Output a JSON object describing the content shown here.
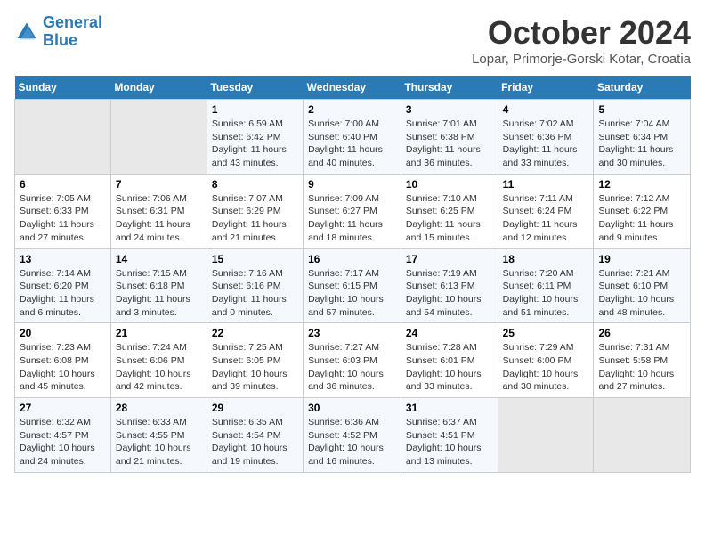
{
  "logo": {
    "line1": "General",
    "line2": "Blue"
  },
  "title": "October 2024",
  "subtitle": "Lopar, Primorje-Gorski Kotar, Croatia",
  "days_of_week": [
    "Sunday",
    "Monday",
    "Tuesday",
    "Wednesday",
    "Thursday",
    "Friday",
    "Saturday"
  ],
  "weeks": [
    [
      {
        "day": "",
        "info": ""
      },
      {
        "day": "",
        "info": ""
      },
      {
        "day": "1",
        "info": "Sunrise: 6:59 AM\nSunset: 6:42 PM\nDaylight: 11 hours and 43 minutes."
      },
      {
        "day": "2",
        "info": "Sunrise: 7:00 AM\nSunset: 6:40 PM\nDaylight: 11 hours and 40 minutes."
      },
      {
        "day": "3",
        "info": "Sunrise: 7:01 AM\nSunset: 6:38 PM\nDaylight: 11 hours and 36 minutes."
      },
      {
        "day": "4",
        "info": "Sunrise: 7:02 AM\nSunset: 6:36 PM\nDaylight: 11 hours and 33 minutes."
      },
      {
        "day": "5",
        "info": "Sunrise: 7:04 AM\nSunset: 6:34 PM\nDaylight: 11 hours and 30 minutes."
      }
    ],
    [
      {
        "day": "6",
        "info": "Sunrise: 7:05 AM\nSunset: 6:33 PM\nDaylight: 11 hours and 27 minutes."
      },
      {
        "day": "7",
        "info": "Sunrise: 7:06 AM\nSunset: 6:31 PM\nDaylight: 11 hours and 24 minutes."
      },
      {
        "day": "8",
        "info": "Sunrise: 7:07 AM\nSunset: 6:29 PM\nDaylight: 11 hours and 21 minutes."
      },
      {
        "day": "9",
        "info": "Sunrise: 7:09 AM\nSunset: 6:27 PM\nDaylight: 11 hours and 18 minutes."
      },
      {
        "day": "10",
        "info": "Sunrise: 7:10 AM\nSunset: 6:25 PM\nDaylight: 11 hours and 15 minutes."
      },
      {
        "day": "11",
        "info": "Sunrise: 7:11 AM\nSunset: 6:24 PM\nDaylight: 11 hours and 12 minutes."
      },
      {
        "day": "12",
        "info": "Sunrise: 7:12 AM\nSunset: 6:22 PM\nDaylight: 11 hours and 9 minutes."
      }
    ],
    [
      {
        "day": "13",
        "info": "Sunrise: 7:14 AM\nSunset: 6:20 PM\nDaylight: 11 hours and 6 minutes."
      },
      {
        "day": "14",
        "info": "Sunrise: 7:15 AM\nSunset: 6:18 PM\nDaylight: 11 hours and 3 minutes."
      },
      {
        "day": "15",
        "info": "Sunrise: 7:16 AM\nSunset: 6:16 PM\nDaylight: 11 hours and 0 minutes."
      },
      {
        "day": "16",
        "info": "Sunrise: 7:17 AM\nSunset: 6:15 PM\nDaylight: 10 hours and 57 minutes."
      },
      {
        "day": "17",
        "info": "Sunrise: 7:19 AM\nSunset: 6:13 PM\nDaylight: 10 hours and 54 minutes."
      },
      {
        "day": "18",
        "info": "Sunrise: 7:20 AM\nSunset: 6:11 PM\nDaylight: 10 hours and 51 minutes."
      },
      {
        "day": "19",
        "info": "Sunrise: 7:21 AM\nSunset: 6:10 PM\nDaylight: 10 hours and 48 minutes."
      }
    ],
    [
      {
        "day": "20",
        "info": "Sunrise: 7:23 AM\nSunset: 6:08 PM\nDaylight: 10 hours and 45 minutes."
      },
      {
        "day": "21",
        "info": "Sunrise: 7:24 AM\nSunset: 6:06 PM\nDaylight: 10 hours and 42 minutes."
      },
      {
        "day": "22",
        "info": "Sunrise: 7:25 AM\nSunset: 6:05 PM\nDaylight: 10 hours and 39 minutes."
      },
      {
        "day": "23",
        "info": "Sunrise: 7:27 AM\nSunset: 6:03 PM\nDaylight: 10 hours and 36 minutes."
      },
      {
        "day": "24",
        "info": "Sunrise: 7:28 AM\nSunset: 6:01 PM\nDaylight: 10 hours and 33 minutes."
      },
      {
        "day": "25",
        "info": "Sunrise: 7:29 AM\nSunset: 6:00 PM\nDaylight: 10 hours and 30 minutes."
      },
      {
        "day": "26",
        "info": "Sunrise: 7:31 AM\nSunset: 5:58 PM\nDaylight: 10 hours and 27 minutes."
      }
    ],
    [
      {
        "day": "27",
        "info": "Sunrise: 6:32 AM\nSunset: 4:57 PM\nDaylight: 10 hours and 24 minutes."
      },
      {
        "day": "28",
        "info": "Sunrise: 6:33 AM\nSunset: 4:55 PM\nDaylight: 10 hours and 21 minutes."
      },
      {
        "day": "29",
        "info": "Sunrise: 6:35 AM\nSunset: 4:54 PM\nDaylight: 10 hours and 19 minutes."
      },
      {
        "day": "30",
        "info": "Sunrise: 6:36 AM\nSunset: 4:52 PM\nDaylight: 10 hours and 16 minutes."
      },
      {
        "day": "31",
        "info": "Sunrise: 6:37 AM\nSunset: 4:51 PM\nDaylight: 10 hours and 13 minutes."
      },
      {
        "day": "",
        "info": ""
      },
      {
        "day": "",
        "info": ""
      }
    ]
  ]
}
